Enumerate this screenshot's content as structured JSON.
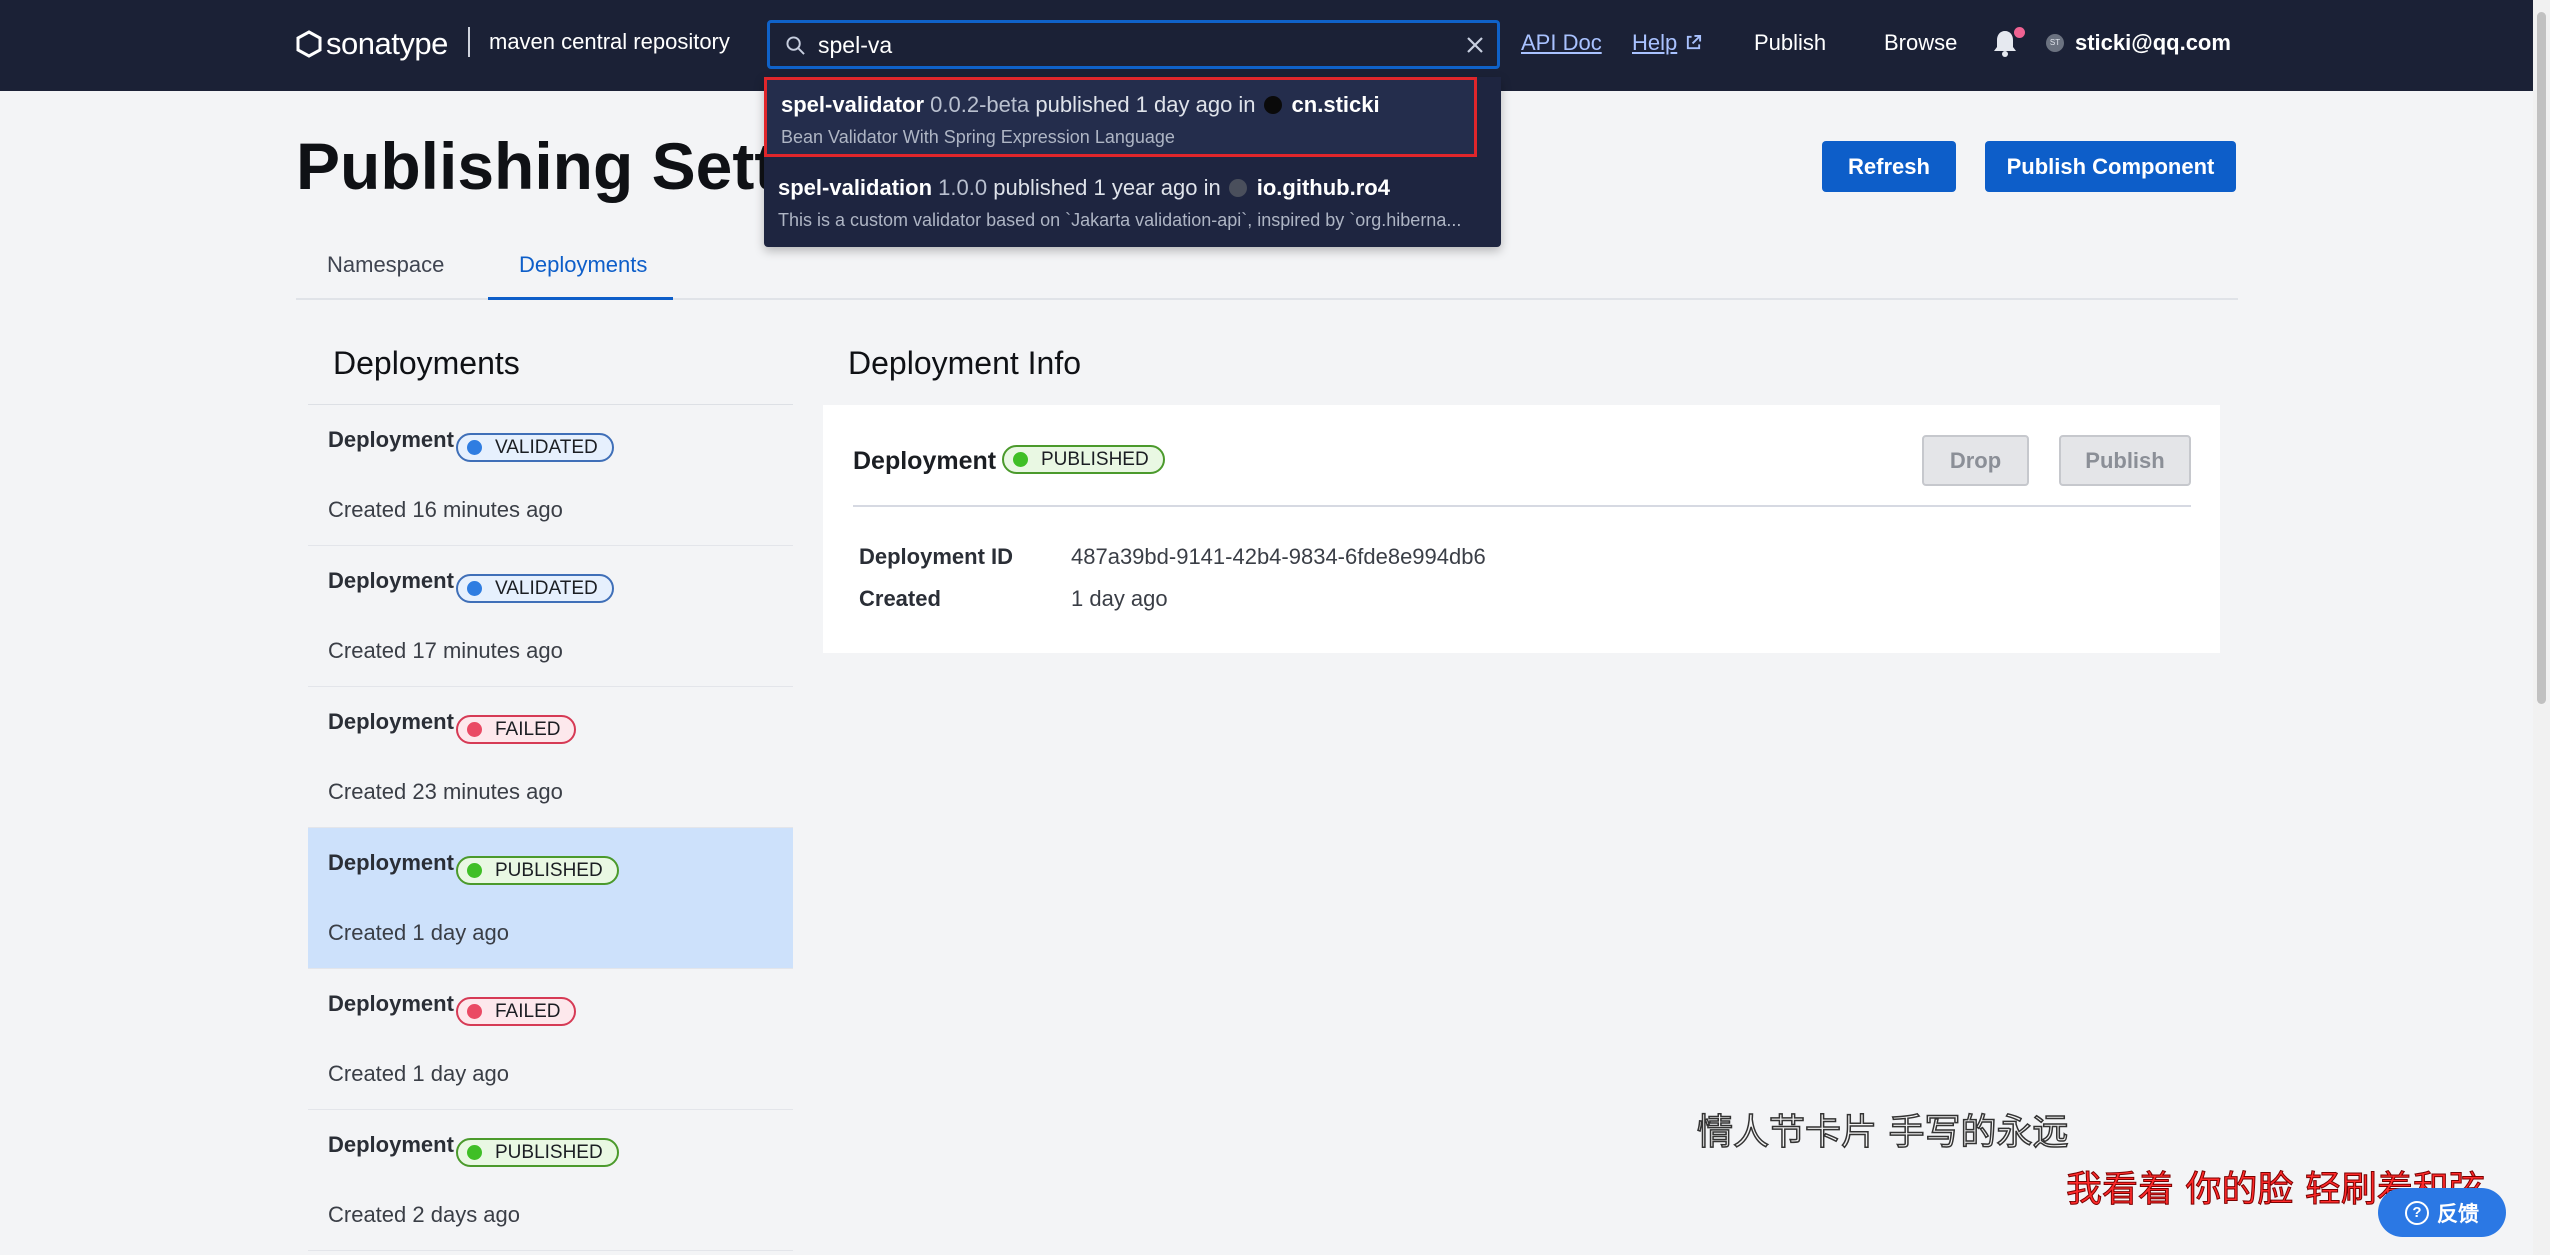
{
  "header": {
    "logo_text": "sonatype",
    "subtitle": "maven central repository",
    "search": {
      "value": "spel-va",
      "placeholder": ""
    },
    "nav": {
      "api_doc": "API Doc",
      "help": "Help",
      "publish": "Publish",
      "browse": "Browse"
    },
    "avatar_initials": "ST",
    "user_email": "sticki@qq.com"
  },
  "page": {
    "title": "Publishing Settings",
    "refresh_label": "Refresh",
    "publish_component_label": "Publish Component",
    "tabs": [
      {
        "label": "Namespace"
      },
      {
        "label": "Deployments"
      }
    ],
    "active_tab": "Deployments"
  },
  "deployments": {
    "title": "Deployments",
    "items": [
      {
        "name": "Deployment",
        "status": "VALIDATED",
        "created": "Created 16 minutes ago"
      },
      {
        "name": "Deployment",
        "status": "VALIDATED",
        "created": "Created 17 minutes ago"
      },
      {
        "name": "Deployment",
        "status": "FAILED",
        "created": "Created 23 minutes ago"
      },
      {
        "name": "Deployment",
        "status": "PUBLISHED",
        "created": "Created 1 day ago"
      },
      {
        "name": "Deployment",
        "status": "FAILED",
        "created": "Created 1 day ago"
      },
      {
        "name": "Deployment",
        "status": "PUBLISHED",
        "created": "Created 2 days ago"
      }
    ]
  },
  "info": {
    "title": "Deployment Info",
    "card_title": "Deployment",
    "status": "PUBLISHED",
    "drop_label": "Drop",
    "publish_label": "Publish",
    "id_label": "Deployment ID",
    "id_value": "487a39bd-9141-42b4-9834-6fde8e994db6",
    "created_label": "Created",
    "created_value": "1 day ago"
  },
  "search_results": [
    {
      "name": "spel-validator",
      "version": "0.0.2-beta",
      "published": "published 1 day ago in",
      "namespace": "cn.sticki",
      "description": "Bean Validator With Spring Expression Language"
    },
    {
      "name": "spel-validation",
      "version": "1.0.0",
      "published": "published 1 year ago in",
      "namespace": "io.github.ro4",
      "description": "This is a custom validator based on `Jakarta validation-api`, inspired by `org.hiberna..."
    }
  ],
  "overlay": {
    "lyric_line1": "情人节卡片 手写的永远",
    "lyric_line2": "我看着 你的脸 轻刷着和弦",
    "feedback_label": "反馈"
  },
  "colors": {
    "topbar": "#1b2136",
    "primary": "#0d5ec9",
    "selected_row": "#cde1fb",
    "highlight_border": "#e0262b"
  }
}
